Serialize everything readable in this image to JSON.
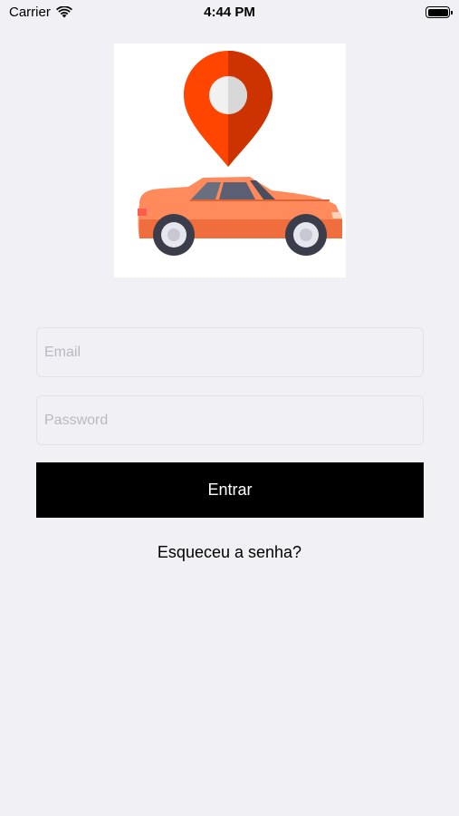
{
  "status_bar": {
    "carrier": "Carrier",
    "time": "4:44 PM",
    "icons": [
      "wifi-icon",
      "battery-icon"
    ]
  },
  "logo": {
    "icon": "location-pin-car-logo",
    "colors": {
      "pin": "#ff4500",
      "pin_shade": "#cc3300",
      "car": "#ff8a5c",
      "car_shade": "#f06d3e",
      "window": "#5a5f73",
      "wheel": "#3b3d4a"
    }
  },
  "form": {
    "email_placeholder": "Email",
    "email_value": "",
    "password_placeholder": "Password",
    "password_value": "",
    "submit_label": "Entrar",
    "forgot_label": "Esqueceu a senha?"
  },
  "colors": {
    "background": "#f0f0f5",
    "button_background": "#000000",
    "button_text": "#ffffff"
  }
}
